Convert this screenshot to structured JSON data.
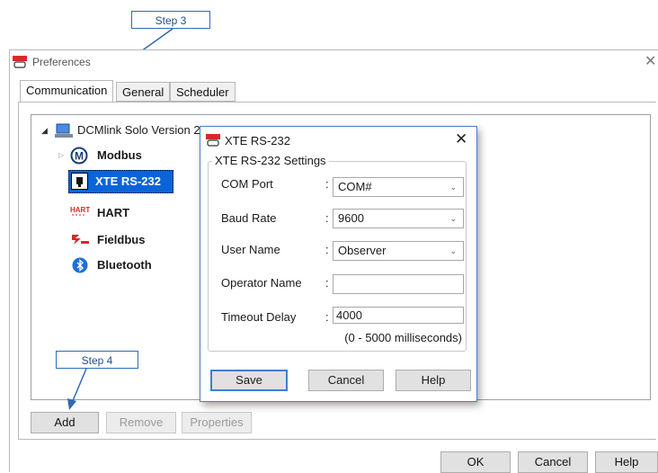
{
  "callouts": {
    "step3": "Step 3",
    "step4": "Step 4"
  },
  "window": {
    "title": "Preferences",
    "app_icon": "DCM"
  },
  "tabs": [
    {
      "label": "Communication"
    },
    {
      "label": "General"
    },
    {
      "label": "Scheduler"
    }
  ],
  "tree": {
    "root_label": "DCMlink Solo Version 2",
    "items": [
      {
        "label": "Modbus",
        "icon": "modbus-icon"
      },
      {
        "label": "XTE RS-232",
        "icon": "xte-icon"
      },
      {
        "label": "HART",
        "icon": "hart-icon"
      },
      {
        "label": "Fieldbus",
        "icon": "fieldbus-icon"
      },
      {
        "label": "Bluetooth",
        "icon": "bluetooth-icon"
      }
    ]
  },
  "panel_buttons": {
    "add": "Add",
    "remove": "Remove",
    "properties": "Properties"
  },
  "footer_buttons": {
    "ok": "OK",
    "cancel": "Cancel",
    "help": "Help"
  },
  "dialog": {
    "title": "XTE RS-232",
    "group_label": "XTE RS-232 Settings",
    "fields": {
      "com_port": {
        "label": "COM Port",
        "value": "COM#"
      },
      "baud_rate": {
        "label": "Baud Rate",
        "value": "9600"
      },
      "user_name": {
        "label": "User Name",
        "value": "Observer"
      },
      "operator_name": {
        "label": "Operator Name",
        "value": ""
      },
      "timeout_delay": {
        "label": "Timeout Delay",
        "value": "4000"
      }
    },
    "timeout_hint": "(0 - 5000 milliseconds)",
    "buttons": {
      "save": "Save",
      "cancel": "Cancel",
      "help": "Help"
    }
  },
  "colors": {
    "callout": "#2f6ab3",
    "selection": "#0a64d8",
    "dialog_border": "#4a7ec9"
  }
}
